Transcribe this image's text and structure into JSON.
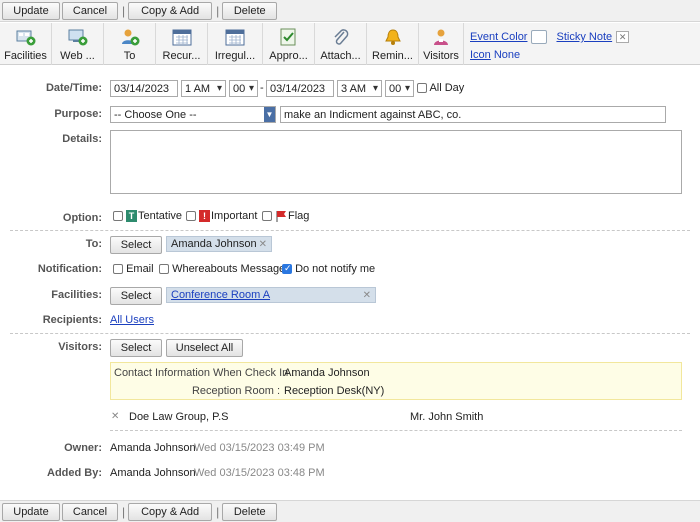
{
  "actions": {
    "update": "Update",
    "cancel": "Cancel",
    "copy_add": "Copy & Add",
    "delete": "Delete"
  },
  "toolbar": {
    "tools": [
      "Facilities",
      "Web ...",
      "To",
      "Recur...",
      "Irregul...",
      "Appro...",
      "Attach...",
      "Remin...",
      "Visitors"
    ],
    "event_color": "Event Color",
    "sticky_note": "Sticky Note",
    "icon": "Icon",
    "icon_value": "None"
  },
  "form": {
    "datetime_label": "Date/Time:",
    "start_date": "03/14/2023",
    "start_hour": "1 AM",
    "start_min": "00",
    "dash": "-",
    "end_date": "03/14/2023",
    "end_hour": "3 AM",
    "end_min": "00",
    "all_day": "All Day",
    "purpose_label": "Purpose:",
    "purpose_select": "-- Choose One --",
    "purpose_text": "make an Indicment against ABC, co.",
    "details_label": "Details:",
    "option_label": "Option:",
    "option_tentative": "Tentative",
    "option_important": "Important",
    "option_flag": "Flag",
    "to_label": "To:",
    "select": "Select",
    "to_value": "Amanda Johnson",
    "notification_label": "Notification:",
    "notif_email": "Email",
    "notif_whereabouts": "Whereabouts Message",
    "notif_do_not_notify": "Do not notify me",
    "facilities_label": "Facilities:",
    "facility_value": "Conference Room A",
    "recipients_label": "Recipients:",
    "recipients_value": "All Users",
    "visitors_label": "Visitors:",
    "unselect_all": "Unselect All",
    "contact_label": "Contact Information When Check In :",
    "contact_value": "Amanda Johnson",
    "reception_label": "Reception Room :",
    "reception_value": "Reception Desk(NY)",
    "visitor_company": "Doe Law Group, P.S",
    "visitor_name": "Mr. John Smith",
    "owner_label": "Owner:",
    "owner_name": "Amanda Johnson",
    "owner_time": "Wed 03/15/2023 03:49 PM",
    "added_label": "Added By:",
    "added_name": "Amanda Johnson",
    "added_time": "Wed 03/15/2023 03:48 PM"
  },
  "colors": {
    "link": "#1a3fbf",
    "chip": "#d4dfea",
    "contact_bg": "#fefde6",
    "contact_border": "#f2e79c",
    "checkbox_on": "#2a77e0"
  }
}
